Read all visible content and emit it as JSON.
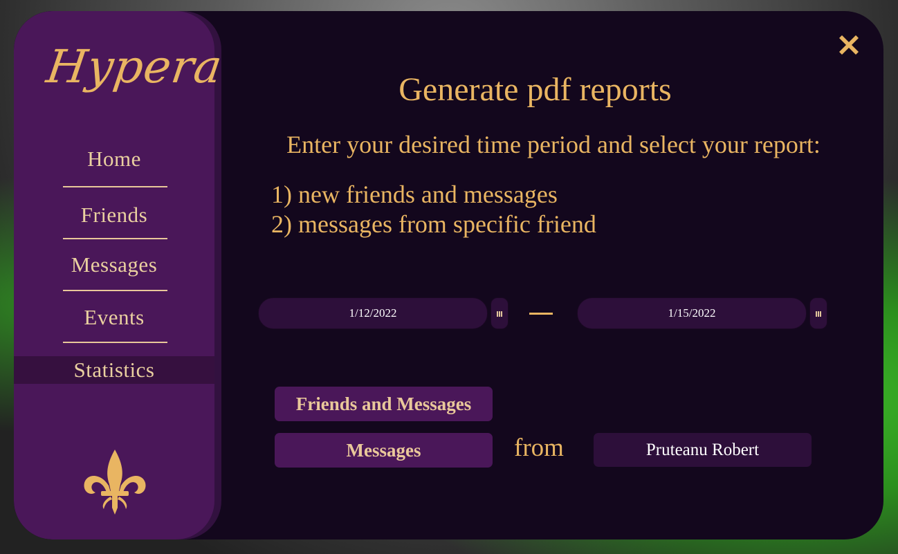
{
  "app": {
    "logo_text": "Hypera"
  },
  "sidebar": {
    "items": [
      {
        "label": "Home"
      },
      {
        "label": "Friends"
      },
      {
        "label": "Messages"
      },
      {
        "label": "Events"
      },
      {
        "label": "Statistics",
        "active": true
      }
    ]
  },
  "main": {
    "title": "Generate pdf reports",
    "subtitle": "Enter your desired time period and select your report:",
    "options": [
      "1) new friends and messages",
      "2) messages from specific friend"
    ],
    "date_range": {
      "start": "1/12/2022",
      "end": "1/15/2022"
    },
    "reports": {
      "friends_and_messages_label": "Friends and Messages",
      "messages_label": "Messages",
      "from_label": "from",
      "selected_friend": "Pruteanu Robert"
    }
  },
  "colors": {
    "accent": "#e9b562",
    "sidebar": "#4a1759",
    "panel": "#13071d",
    "field": "#2d0f3a"
  },
  "icons": [
    "close-icon",
    "calendar-icon",
    "fleur-de-lis-icon"
  ]
}
